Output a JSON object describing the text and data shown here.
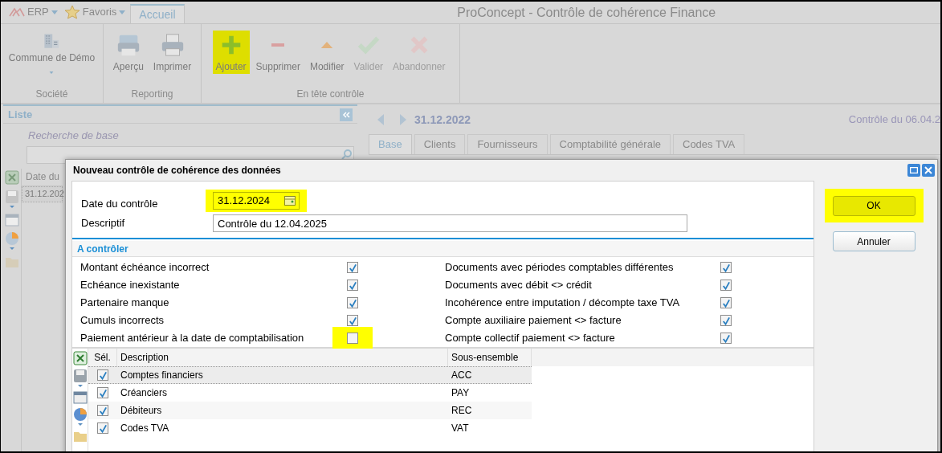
{
  "app": {
    "menus": [
      {
        "label": "ERP",
        "kind": "logo"
      },
      {
        "label": "Favoris",
        "kind": "star"
      }
    ],
    "tabs": [
      {
        "label": "Accueil",
        "selected": true
      }
    ],
    "title": "ProConcept - Contrôle de cohérence Finance"
  },
  "ribbon": {
    "groups": [
      {
        "label": "Société",
        "buttons": [
          {
            "label": "Commune de Démo",
            "kind": "building",
            "dropdown": true,
            "disabled": false,
            "highlighted": false
          }
        ]
      },
      {
        "label": "Reporting",
        "buttons": [
          {
            "label": "Aperçu",
            "kind": "preview",
            "dropdown": false,
            "disabled": false,
            "highlighted": false
          },
          {
            "label": "Imprimer",
            "kind": "printer",
            "dropdown": false,
            "disabled": false,
            "highlighted": false
          }
        ]
      },
      {
        "label": "En tête contrôle",
        "buttons": [
          {
            "label": "Ajouter",
            "kind": "plus",
            "dropdown": false,
            "disabled": false,
            "highlighted": true
          },
          {
            "label": "Supprimer",
            "kind": "minus",
            "dropdown": false,
            "disabled": false,
            "highlighted": false
          },
          {
            "label": "Modifier",
            "kind": "triangle",
            "dropdown": false,
            "disabled": false,
            "highlighted": false
          },
          {
            "label": "Valider",
            "kind": "check",
            "dropdown": false,
            "disabled": true,
            "highlighted": false
          },
          {
            "label": "Abandonner",
            "kind": "cross",
            "dropdown": false,
            "disabled": true,
            "highlighted": false
          }
        ]
      }
    ]
  },
  "list_panel": {
    "title": "Liste",
    "search": {
      "label": "Recherche de base"
    },
    "columns": [
      "Date du"
    ],
    "rows": [
      [
        "31.12.202"
      ]
    ]
  },
  "detail": {
    "date": "31.12.2022",
    "caption": "Contrôle du 06.04.2",
    "tabs": [
      {
        "label": "Base",
        "selected": true
      },
      {
        "label": "Clients",
        "selected": false
      },
      {
        "label": "Fournisseurs",
        "selected": false
      },
      {
        "label": "Comptabilité générale",
        "selected": false
      },
      {
        "label": "Codes TVA",
        "selected": false
      }
    ]
  },
  "dialog": {
    "title": "Nouveau contrôle de cohérence des données",
    "date_field": {
      "label": "Date du contrôle",
      "value": "31.12.2024",
      "highlighted": true
    },
    "description_field": {
      "label": "Descriptif",
      "value": "Contrôle du 12.04.2025"
    },
    "section": "A contrôler",
    "checks": [
      {
        "label": "Montant échéance incorrect",
        "checked": true,
        "highlighted": false
      },
      {
        "label": "Echéance inexistante",
        "checked": true,
        "highlighted": false
      },
      {
        "label": "Partenaire manque",
        "checked": true,
        "highlighted": false
      },
      {
        "label": "Cumuls incorrects",
        "checked": true,
        "highlighted": false
      },
      {
        "label": "Paiement antérieur à la date de comptabilisation",
        "checked": false,
        "highlighted": true
      },
      {
        "label": "Documents avec périodes comptables différentes",
        "checked": true,
        "highlighted": false
      },
      {
        "label": "Documents avec débit <> crédit",
        "checked": true,
        "highlighted": false
      },
      {
        "label": "Incohérence entre imputation / décompte taxe TVA",
        "checked": true,
        "highlighted": false
      },
      {
        "label": "Compte auxiliaire paiement <> facture",
        "checked": true,
        "highlighted": false
      },
      {
        "label": "Compte collectif paiement <> facture",
        "checked": true,
        "highlighted": false
      }
    ],
    "grid": {
      "columns": [
        "Sél.",
        "Description",
        "Sous-ensemble"
      ],
      "rows": [
        {
          "checked": true,
          "description": "Comptes financiers",
          "subset": "ACC",
          "selected": true
        },
        {
          "checked": true,
          "description": "Créanciers",
          "subset": "PAY",
          "selected": false
        },
        {
          "checked": true,
          "description": "Débiteurs",
          "subset": "REC",
          "selected": false
        },
        {
          "checked": true,
          "description": "Codes TVA",
          "subset": "VAT",
          "selected": false
        }
      ]
    },
    "buttons": [
      {
        "label": "OK",
        "highlighted": true
      },
      {
        "label": "Annuler",
        "highlighted": false
      }
    ]
  }
}
